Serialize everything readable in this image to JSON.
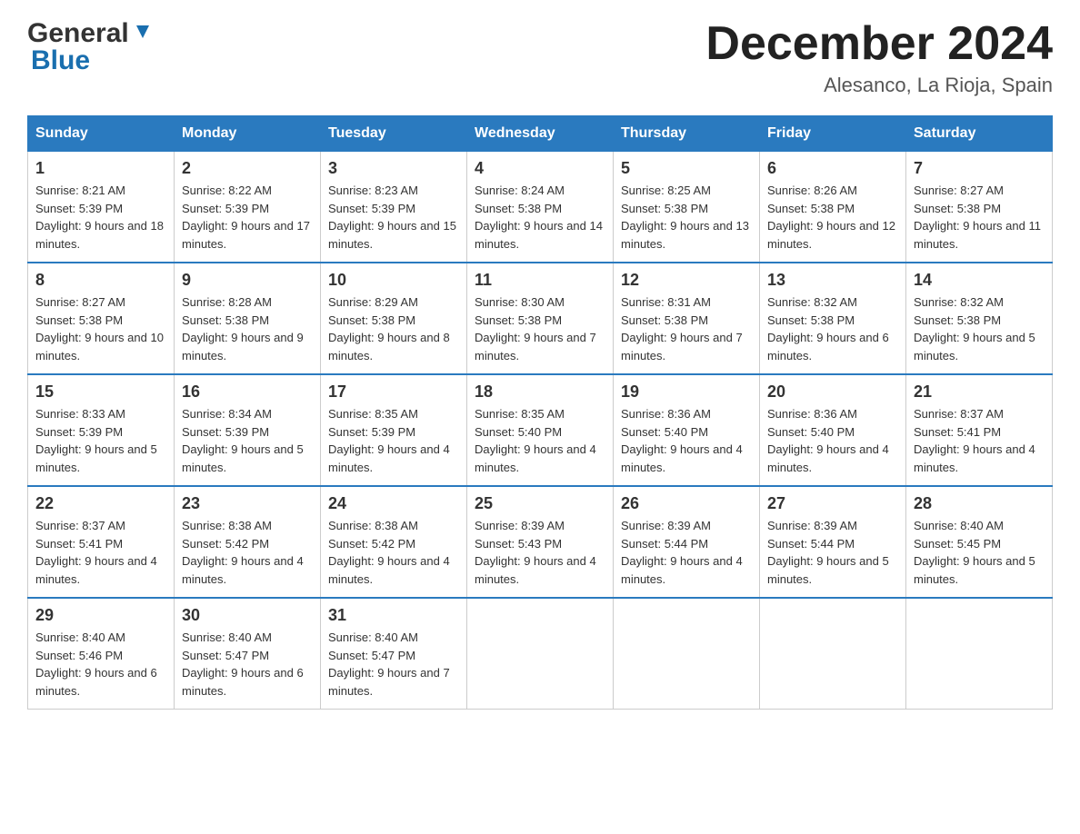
{
  "header": {
    "logo": {
      "general": "General",
      "blue": "Blue",
      "arrow_unicode": "▼"
    },
    "title": "December 2024",
    "location": "Alesanco, La Rioja, Spain"
  },
  "calendar": {
    "days_of_week": [
      "Sunday",
      "Monday",
      "Tuesday",
      "Wednesday",
      "Thursday",
      "Friday",
      "Saturday"
    ],
    "weeks": [
      [
        {
          "day": "1",
          "sunrise": "Sunrise: 8:21 AM",
          "sunset": "Sunset: 5:39 PM",
          "daylight": "Daylight: 9 hours and 18 minutes."
        },
        {
          "day": "2",
          "sunrise": "Sunrise: 8:22 AM",
          "sunset": "Sunset: 5:39 PM",
          "daylight": "Daylight: 9 hours and 17 minutes."
        },
        {
          "day": "3",
          "sunrise": "Sunrise: 8:23 AM",
          "sunset": "Sunset: 5:39 PM",
          "daylight": "Daylight: 9 hours and 15 minutes."
        },
        {
          "day": "4",
          "sunrise": "Sunrise: 8:24 AM",
          "sunset": "Sunset: 5:38 PM",
          "daylight": "Daylight: 9 hours and 14 minutes."
        },
        {
          "day": "5",
          "sunrise": "Sunrise: 8:25 AM",
          "sunset": "Sunset: 5:38 PM",
          "daylight": "Daylight: 9 hours and 13 minutes."
        },
        {
          "day": "6",
          "sunrise": "Sunrise: 8:26 AM",
          "sunset": "Sunset: 5:38 PM",
          "daylight": "Daylight: 9 hours and 12 minutes."
        },
        {
          "day": "7",
          "sunrise": "Sunrise: 8:27 AM",
          "sunset": "Sunset: 5:38 PM",
          "daylight": "Daylight: 9 hours and 11 minutes."
        }
      ],
      [
        {
          "day": "8",
          "sunrise": "Sunrise: 8:27 AM",
          "sunset": "Sunset: 5:38 PM",
          "daylight": "Daylight: 9 hours and 10 minutes."
        },
        {
          "day": "9",
          "sunrise": "Sunrise: 8:28 AM",
          "sunset": "Sunset: 5:38 PM",
          "daylight": "Daylight: 9 hours and 9 minutes."
        },
        {
          "day": "10",
          "sunrise": "Sunrise: 8:29 AM",
          "sunset": "Sunset: 5:38 PM",
          "daylight": "Daylight: 9 hours and 8 minutes."
        },
        {
          "day": "11",
          "sunrise": "Sunrise: 8:30 AM",
          "sunset": "Sunset: 5:38 PM",
          "daylight": "Daylight: 9 hours and 7 minutes."
        },
        {
          "day": "12",
          "sunrise": "Sunrise: 8:31 AM",
          "sunset": "Sunset: 5:38 PM",
          "daylight": "Daylight: 9 hours and 7 minutes."
        },
        {
          "day": "13",
          "sunrise": "Sunrise: 8:32 AM",
          "sunset": "Sunset: 5:38 PM",
          "daylight": "Daylight: 9 hours and 6 minutes."
        },
        {
          "day": "14",
          "sunrise": "Sunrise: 8:32 AM",
          "sunset": "Sunset: 5:38 PM",
          "daylight": "Daylight: 9 hours and 5 minutes."
        }
      ],
      [
        {
          "day": "15",
          "sunrise": "Sunrise: 8:33 AM",
          "sunset": "Sunset: 5:39 PM",
          "daylight": "Daylight: 9 hours and 5 minutes."
        },
        {
          "day": "16",
          "sunrise": "Sunrise: 8:34 AM",
          "sunset": "Sunset: 5:39 PM",
          "daylight": "Daylight: 9 hours and 5 minutes."
        },
        {
          "day": "17",
          "sunrise": "Sunrise: 8:35 AM",
          "sunset": "Sunset: 5:39 PM",
          "daylight": "Daylight: 9 hours and 4 minutes."
        },
        {
          "day": "18",
          "sunrise": "Sunrise: 8:35 AM",
          "sunset": "Sunset: 5:40 PM",
          "daylight": "Daylight: 9 hours and 4 minutes."
        },
        {
          "day": "19",
          "sunrise": "Sunrise: 8:36 AM",
          "sunset": "Sunset: 5:40 PM",
          "daylight": "Daylight: 9 hours and 4 minutes."
        },
        {
          "day": "20",
          "sunrise": "Sunrise: 8:36 AM",
          "sunset": "Sunset: 5:40 PM",
          "daylight": "Daylight: 9 hours and 4 minutes."
        },
        {
          "day": "21",
          "sunrise": "Sunrise: 8:37 AM",
          "sunset": "Sunset: 5:41 PM",
          "daylight": "Daylight: 9 hours and 4 minutes."
        }
      ],
      [
        {
          "day": "22",
          "sunrise": "Sunrise: 8:37 AM",
          "sunset": "Sunset: 5:41 PM",
          "daylight": "Daylight: 9 hours and 4 minutes."
        },
        {
          "day": "23",
          "sunrise": "Sunrise: 8:38 AM",
          "sunset": "Sunset: 5:42 PM",
          "daylight": "Daylight: 9 hours and 4 minutes."
        },
        {
          "day": "24",
          "sunrise": "Sunrise: 8:38 AM",
          "sunset": "Sunset: 5:42 PM",
          "daylight": "Daylight: 9 hours and 4 minutes."
        },
        {
          "day": "25",
          "sunrise": "Sunrise: 8:39 AM",
          "sunset": "Sunset: 5:43 PM",
          "daylight": "Daylight: 9 hours and 4 minutes."
        },
        {
          "day": "26",
          "sunrise": "Sunrise: 8:39 AM",
          "sunset": "Sunset: 5:44 PM",
          "daylight": "Daylight: 9 hours and 4 minutes."
        },
        {
          "day": "27",
          "sunrise": "Sunrise: 8:39 AM",
          "sunset": "Sunset: 5:44 PM",
          "daylight": "Daylight: 9 hours and 5 minutes."
        },
        {
          "day": "28",
          "sunrise": "Sunrise: 8:40 AM",
          "sunset": "Sunset: 5:45 PM",
          "daylight": "Daylight: 9 hours and 5 minutes."
        }
      ],
      [
        {
          "day": "29",
          "sunrise": "Sunrise: 8:40 AM",
          "sunset": "Sunset: 5:46 PM",
          "daylight": "Daylight: 9 hours and 6 minutes."
        },
        {
          "day": "30",
          "sunrise": "Sunrise: 8:40 AM",
          "sunset": "Sunset: 5:47 PM",
          "daylight": "Daylight: 9 hours and 6 minutes."
        },
        {
          "day": "31",
          "sunrise": "Sunrise: 8:40 AM",
          "sunset": "Sunset: 5:47 PM",
          "daylight": "Daylight: 9 hours and 7 minutes."
        },
        null,
        null,
        null,
        null
      ]
    ]
  }
}
